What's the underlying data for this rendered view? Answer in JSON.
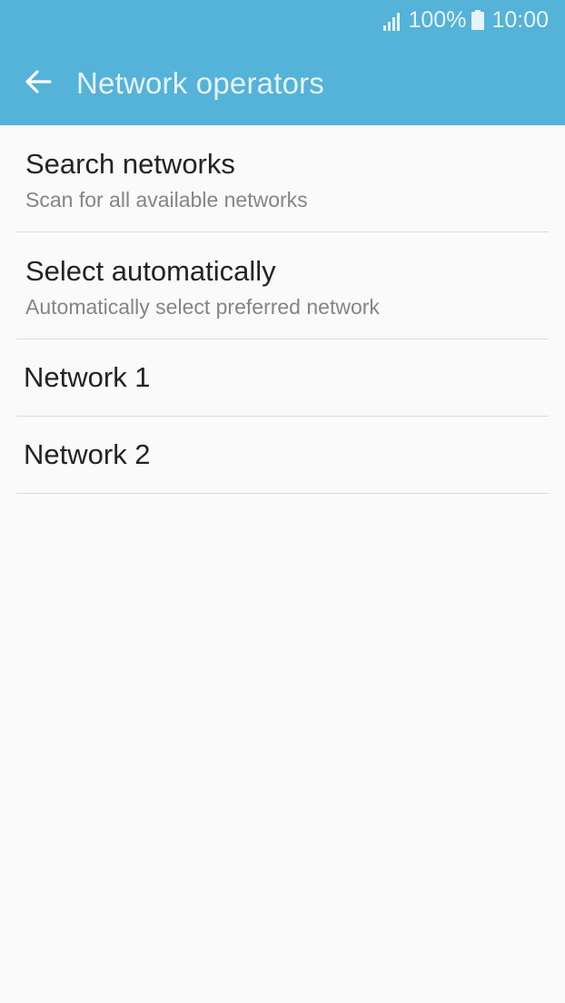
{
  "status_bar": {
    "battery_percent": "100%",
    "time": "10:00",
    "signal_icon": "signal-bars-icon",
    "battery_icon": "battery-full-icon"
  },
  "app_bar": {
    "back_icon": "arrow-left-icon",
    "title": "Network operators"
  },
  "colors": {
    "header": "#55b2d8",
    "background": "#fafafa",
    "title_text": "#232323",
    "subtitle_text": "#858585",
    "divider": "#dcdcdc"
  },
  "items": [
    {
      "title": "Search networks",
      "subtitle": "Scan for all available networks"
    },
    {
      "title": "Select automatically",
      "subtitle": "Automatically select preferred network"
    },
    {
      "title": "Network 1"
    },
    {
      "title": "Network 2"
    }
  ]
}
